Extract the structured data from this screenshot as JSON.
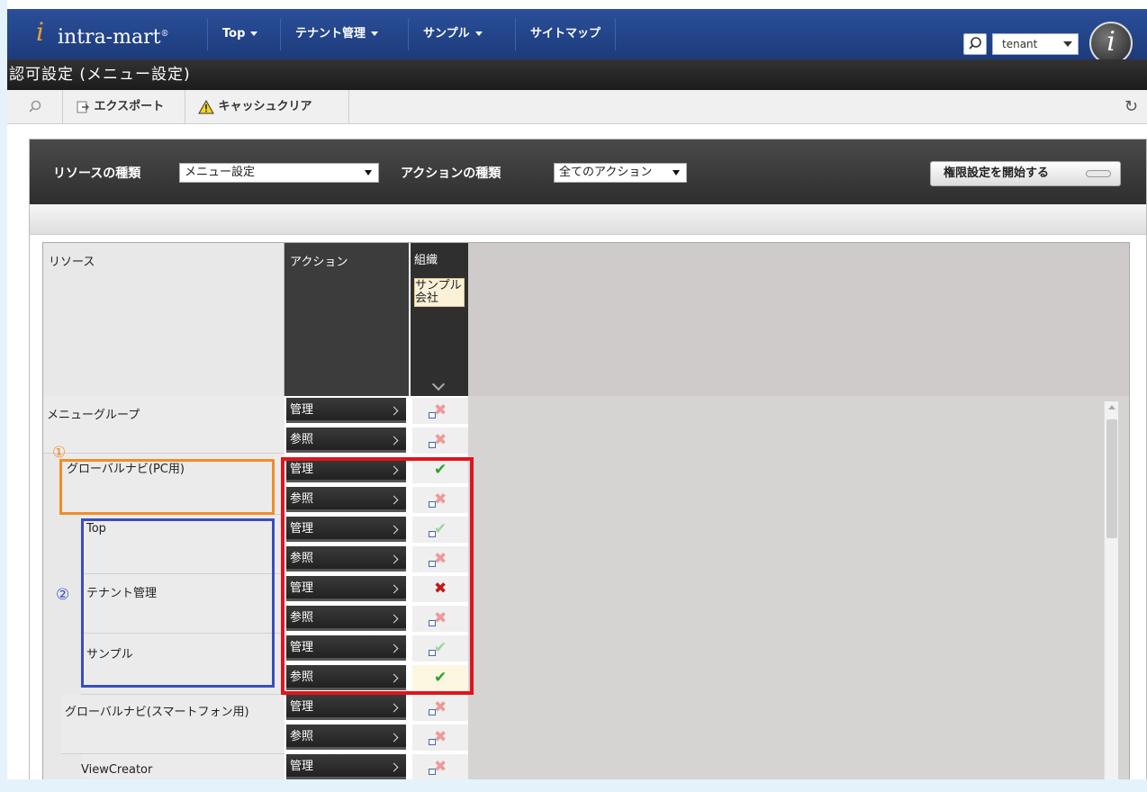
{
  "nav": {
    "logo": "intra-mart",
    "logo_mark": "i",
    "items": [
      {
        "label": "Top"
      },
      {
        "label": "テナント管理"
      },
      {
        "label": "サンプル"
      },
      {
        "label": "サイトマップ"
      }
    ],
    "user": "tenant",
    "avatar_letter": "i"
  },
  "page": {
    "title": "認可設定 (メニュー設定)",
    "toolbar": {
      "export_label": "エクスポート",
      "cache_clear_label": "キャッシュクリア"
    }
  },
  "panel": {
    "resource_type_label": "リソースの種類",
    "resource_type_value": "メニュー設定",
    "action_type_label": "アクションの種類",
    "action_type_value": "全てのアクション",
    "start_button": "権限設定を開始する"
  },
  "grid": {
    "headers": {
      "resource": "リソース",
      "action": "アクション",
      "org_group": "組織",
      "org_name": "サンプル会社"
    },
    "resources": [
      "メニューグループ",
      "グローバルナビ(PC用)",
      "Top",
      "テナント管理",
      "サンプル",
      "グローバルナビ(スマートフォン用)",
      "ViewCreator"
    ],
    "actions": {
      "manage": "管理",
      "view": "参照"
    },
    "rows": [
      {
        "resource_index": 0,
        "action": "管理",
        "state": "deny-inherited"
      },
      {
        "resource_index": 0,
        "action": "参照",
        "state": "deny-inherited"
      },
      {
        "resource_index": 1,
        "action": "管理",
        "state": "grant"
      },
      {
        "resource_index": 1,
        "action": "参照",
        "state": "deny-inherited"
      },
      {
        "resource_index": 2,
        "action": "管理",
        "state": "grant-inherited"
      },
      {
        "resource_index": 2,
        "action": "参照",
        "state": "deny-inherited"
      },
      {
        "resource_index": 3,
        "action": "管理",
        "state": "deny"
      },
      {
        "resource_index": 3,
        "action": "参照",
        "state": "deny-inherited"
      },
      {
        "resource_index": 4,
        "action": "管理",
        "state": "grant-inherited"
      },
      {
        "resource_index": 4,
        "action": "参照",
        "state": "grant"
      },
      {
        "resource_index": 5,
        "action": "管理",
        "state": "deny-inherited"
      },
      {
        "resource_index": 5,
        "action": "参照",
        "state": "deny-inherited"
      },
      {
        "resource_index": 6,
        "action": "管理",
        "state": "deny-inherited"
      }
    ]
  },
  "annotations": {
    "one": "①",
    "two": "②"
  },
  "colors": {
    "nav_bg": "#1d3b7b",
    "title_bg": "#1b1b1b",
    "grant": "#2da02d",
    "deny": "#c31919",
    "annotation_orange": "#f28c28",
    "annotation_blue": "#3b4cc0",
    "annotation_red": "#e0141e"
  }
}
